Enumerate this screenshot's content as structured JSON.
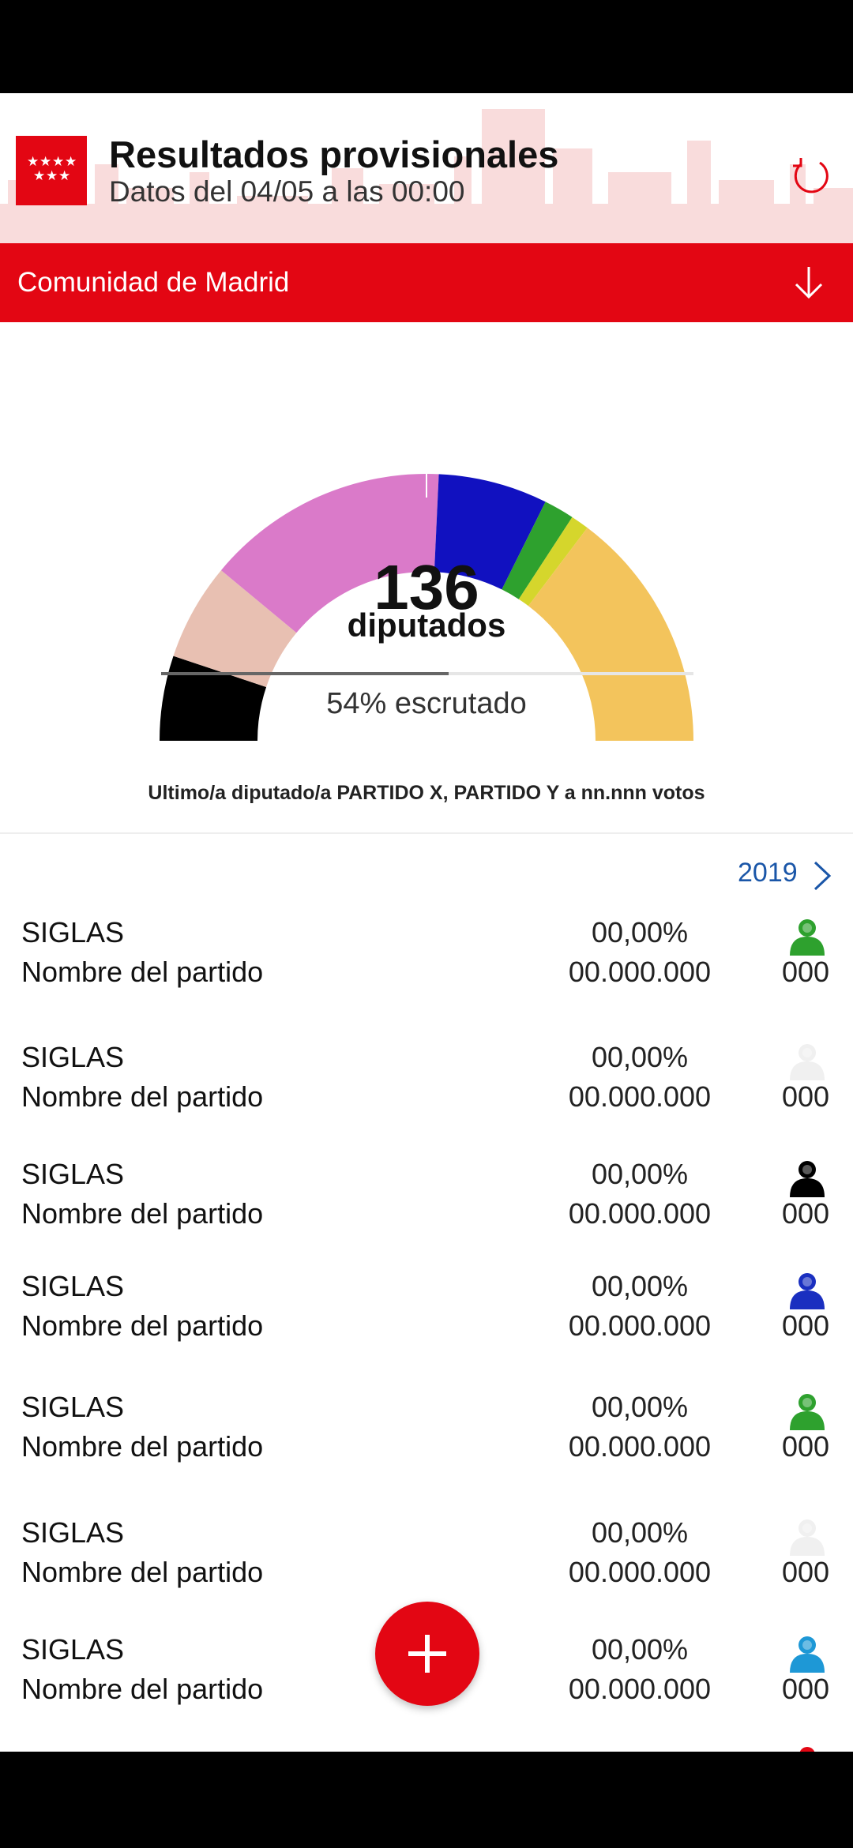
{
  "header": {
    "title": "Resultados provisionales",
    "subtitle": "Datos del 04/05 a las 00:00"
  },
  "region": {
    "label": "Comunidad de Madrid"
  },
  "chart_data": {
    "type": "pie",
    "series": [
      {
        "color": "#000000",
        "value": 14
      },
      {
        "color": "#e8c0b2",
        "value": 16
      },
      {
        "color": "#da7ac9",
        "value": 40
      },
      {
        "color": "#1111c0",
        "value": 18
      },
      {
        "color": "#2ea12e",
        "value": 5
      },
      {
        "color": "#d5d62c",
        "value": 3
      },
      {
        "color": "#f3c45c",
        "value": 40
      }
    ],
    "total_label": "136",
    "total_caption": "diputados"
  },
  "progress": {
    "percent": 54,
    "label": "54% escrutado"
  },
  "last_seat": "Ultimo/a  diputado/a PARTIDO X, PARTIDO Y a nn.nnn votos",
  "year_link": "2019",
  "parties": [
    {
      "siglas": "SIGLAS",
      "name": "Nombre del partido",
      "pct": "00,00%",
      "votes": "00.000.000",
      "seats": "000",
      "icon_color": "#2ea12e"
    },
    {
      "siglas": "SIGLAS",
      "name": "Nombre del partido",
      "pct": "00,00%",
      "votes": "00.000.000",
      "seats": "000",
      "icon_color": "#f0f0f0"
    },
    {
      "siglas": "SIGLAS",
      "name": "Nombre del partido",
      "pct": "00,00%",
      "votes": "00.000.000",
      "seats": "000",
      "icon_color": "#000000"
    },
    {
      "siglas": "SIGLAS",
      "name": "Nombre del partido",
      "pct": "00,00%",
      "votes": "00.000.000",
      "seats": "000",
      "icon_color": "#1a2fc0"
    },
    {
      "siglas": "SIGLAS",
      "name": "Nombre del partido",
      "pct": "00,00%",
      "votes": "00.000.000",
      "seats": "000",
      "icon_color": "#2ea12e"
    },
    {
      "siglas": "SIGLAS",
      "name": "Nombre del partido",
      "pct": "00,00%",
      "votes": "00.000.000",
      "seats": "000",
      "icon_color": "#f0f0f0"
    },
    {
      "siglas": "SIGLAS",
      "name": "Nombre del partido",
      "pct": "00,00%",
      "votes": "00.000.000",
      "seats": "000",
      "icon_color": "#1e98d6"
    }
  ],
  "colors": {
    "brand_red": "#e30613",
    "link_blue": "#1a56a8"
  }
}
